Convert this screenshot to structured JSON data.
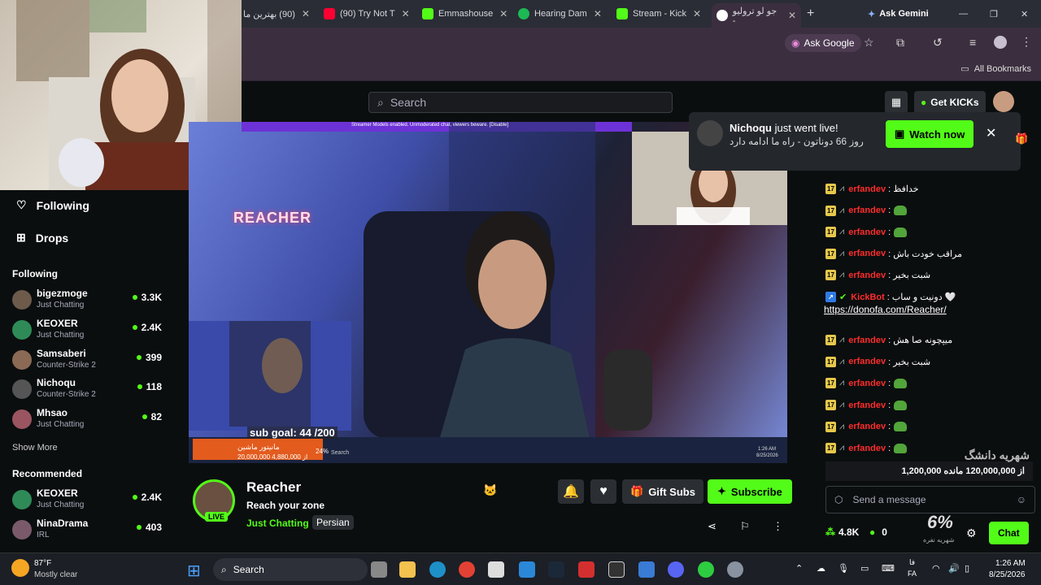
{
  "browser": {
    "tabs": [
      {
        "label": "(90) بهترین ما",
        "color": "#ff0033"
      },
      {
        "label": "(90) Try Not T",
        "color": "#ff0033"
      },
      {
        "label": "Emmashouse",
        "color": "#53fc18"
      },
      {
        "label": "Hearing Dam",
        "color": "#1db954"
      },
      {
        "label": "Stream - Kick",
        "color": "#53fc18"
      },
      {
        "label": "جو لو ترولیو -",
        "color": "#4285f4"
      }
    ],
    "new_tab": "+",
    "ask_gemini": "Ask Gemini",
    "ask_google": "Ask Google",
    "all_bookmarks": "All Bookmarks"
  },
  "kick": {
    "search_placeholder": "Search",
    "get_kicks": "Get KICKs"
  },
  "sidebar": {
    "following_nav": "Following",
    "drops_nav": "Drops",
    "following_header": "Following",
    "following": [
      {
        "name": "bigezmoge",
        "category": "Just Chatting",
        "viewers": "3.3K",
        "color": "#6d5a4a"
      },
      {
        "name": "KEOXER",
        "category": "Just Chatting",
        "viewers": "2.4K",
        "color": "#2e8b57"
      },
      {
        "name": "Samsaberi",
        "category": "Counter-Strike 2",
        "viewers": "399",
        "color": "#8a6a55"
      },
      {
        "name": "Nichoqu",
        "category": "Counter-Strike 2",
        "viewers": "118",
        "color": "#555"
      },
      {
        "name": "Mhsao",
        "category": "Just Chatting",
        "viewers": "82",
        "color": "#9a5560"
      }
    ],
    "show_more": "Show More",
    "recommended_header": "Recommended",
    "recommended": [
      {
        "name": "KEOXER",
        "category": "Just Chatting",
        "viewers": "2.4K",
        "color": "#2e8b57"
      },
      {
        "name": "NinaDrama",
        "category": "IRL",
        "viewers": "403",
        "color": "#7a5a6a"
      }
    ]
  },
  "video": {
    "banner_text": "Streamer Models enabled. Unmoderated chat, viewers beware. [Disable]",
    "room_sign": "REACHER",
    "sub_goal": "sub goal: 44 /200",
    "donation_title": "مانیتور ماشین",
    "donation_progress": "20,000,000 از 4,880,000",
    "donation_percent": "24%",
    "inner_search": "Search",
    "inner_time": "1:26 AM",
    "inner_date": "8/25/2026"
  },
  "stream": {
    "name": "Reacher",
    "title": "Reach your zone",
    "category": "Just Chatting",
    "tag": "Persian",
    "live_badge": "LIVE",
    "gift_subs": "Gift Subs",
    "subscribe": "Subscribe"
  },
  "notification": {
    "streamer": "Nichoqu",
    "action": " just went live!",
    "subtitle": "روز 66 دوناتون - راه ما ادامه دارد",
    "watch_now": "Watch now"
  },
  "chat": {
    "messages": [
      {
        "user": "erfandev",
        "text": ": خدافظ",
        "frog": false
      },
      {
        "user": "erfandev",
        "text": ":",
        "frog": true
      },
      {
        "user": "erfandev",
        "text": ":",
        "frog": true
      },
      {
        "user": "erfandev",
        "text": ": مراقب خودت باش",
        "frog": false
      },
      {
        "user": "erfandev",
        "text": ": شبت بخیر",
        "frog": false
      },
      {
        "user": "KickBot",
        "text": ": دونیت و ساب 🤍",
        "frog": false,
        "bot": true
      },
      {
        "user": "",
        "text": "https://donofa.com/Reacher/",
        "frog": false,
        "link": true
      },
      {
        "user": "erfandev",
        "text": ": میپچونه صا هش",
        "frog": false
      },
      {
        "user": "erfandev",
        "text": ": شبت بخیر",
        "frog": false
      },
      {
        "user": "erfandev",
        "text": ":",
        "frog": true
      },
      {
        "user": "erfandev",
        "text": ":",
        "frog": true
      },
      {
        "user": "erfandev",
        "text": ":",
        "frog": true
      },
      {
        "user": "erfandev",
        "text": ":",
        "frog": true
      },
      {
        "user": "erfandev",
        "text": ":",
        "frog": true
      }
    ],
    "overlay_name": "شهریه دانشگ",
    "overlay_goal": "1,200,000 از 120,000,000 مانده",
    "send_placeholder": "Send a message",
    "followers": "4.8K",
    "kicks_count": "0",
    "percent": "6%",
    "percent_label": "شهریه نفره",
    "chat_button": "Chat"
  },
  "taskbar": {
    "weather_temp": "87°F",
    "weather_desc": "Mostly clear",
    "search": "Search",
    "lang_top": "فا",
    "lang_bottom": "FA",
    "time": "1:26 AM",
    "date": "8/25/2026"
  }
}
